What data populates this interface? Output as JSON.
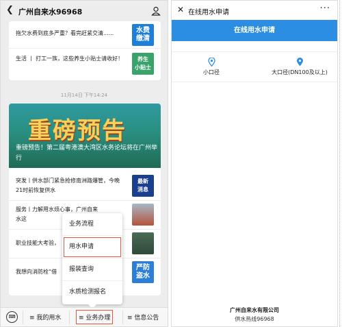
{
  "left": {
    "header": {
      "back_icon": "chevron-left-icon",
      "title": "广州自来水96968",
      "profile_icon": "person-icon"
    },
    "top_articles": [
      {
        "text": "拖欠水费到底多严重？看完赶紧交清......",
        "thumb_text": "水费\n缴清",
        "thumb_color": "#1e7fd8"
      },
      {
        "text": "生活 丨 打工一族，这些养生小贴士请收好！",
        "thumb_text": "养生\n小贴士",
        "thumb_color": "#3aa26b"
      }
    ],
    "timestamp": "11月14日 下午14:24",
    "banner": {
      "big_text": "重磅预告",
      "caption": "重磅预告！第二届粤港澳大湾区水务论坛将在广州举行"
    },
    "articles": [
      {
        "text": "突发丨供水部门紧急抢修南洲路爆管，今晚21时前恢复供水",
        "thumb_text": "最新\n消息",
        "thumb_color": "#1b3f8f"
      },
      {
        "text": "服务丨力解用水烦心事，广州自来水这",
        "suffix": "次",
        "line2": "好",
        "thumb_text": "",
        "thumb_color": "#b5533a"
      },
      {
        "text": "职业技能大考验，",
        "thumb_text": "",
        "thumb_color": "#3d6d4a"
      },
      {
        "text": "我想向消防栓“借",
        "thumb_text": "严防\n盗水",
        "thumb_color": "#2c7fd4"
      }
    ],
    "menu": {
      "items": [
        "业务流程",
        "用水申请",
        "报装查询",
        "水质检测报名"
      ],
      "selected_index": 1
    },
    "bottombar": {
      "keyboard_icon": "keyboard-icon",
      "tabs": [
        "≡ 我的用水",
        "≡ 业务办理",
        "≡ 信息公告"
      ],
      "selected_index": 1
    }
  },
  "right": {
    "header": {
      "close_icon": "close-icon",
      "title": "在线用水申请",
      "more_icon": "more-icon",
      "more_text": "···"
    },
    "blue_bar": "在线用水申请",
    "calibers": [
      {
        "label": "小口径",
        "icon": "location-pin-icon"
      },
      {
        "label": "大口径(DN100及以上)",
        "icon": "location-pin-icon"
      }
    ],
    "company": "广州自来水有限公司",
    "hotline": "供水热线96968"
  },
  "colors": {
    "accent_blue": "#2b8ee3",
    "highlight_red": "#e4553b",
    "banner_teal": "#2a8f80"
  }
}
